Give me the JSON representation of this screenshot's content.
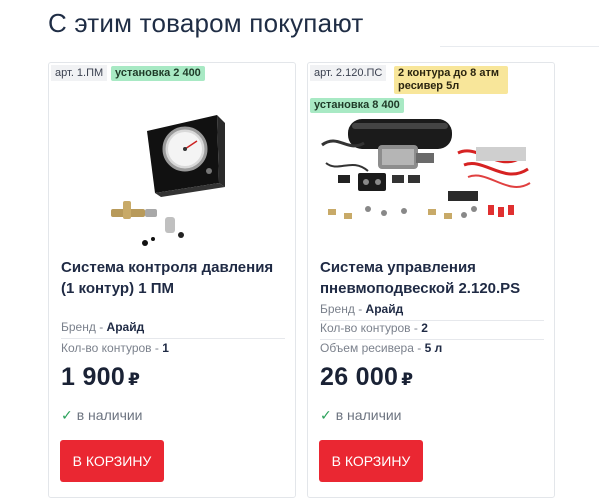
{
  "section": {
    "title": "С этим товаром покупают"
  },
  "currency_symbol": "₽",
  "cards": [
    {
      "article": "арт. 1.ПМ",
      "badges": [
        "установка 2 400"
      ],
      "name": "Система контроля давления (1 контур) 1 ПМ",
      "specs": [
        {
          "label": "Бренд",
          "value": "Арайд"
        },
        {
          "label": "Кол-во контуров",
          "value": "1"
        }
      ],
      "price": "1 900",
      "stock": "в наличии",
      "cart_label": "В КОРЗИНУ"
    },
    {
      "article": "арт. 2.120.ПС",
      "badges": [
        "2 контура до 8 атм ресивер 5л",
        "установка 8 400"
      ],
      "name": "Система управления пневмоподвеской 2.120.PS",
      "specs": [
        {
          "label": "Бренд",
          "value": "Арайд"
        },
        {
          "label": "Кол-во контуров",
          "value": "2"
        },
        {
          "label": "Объем ресивера",
          "value": "5 л"
        }
      ],
      "price": "26 000",
      "stock": "в наличии",
      "cart_label": "В КОРЗИНУ"
    }
  ],
  "colors": {
    "accent_button": "#ea2732",
    "badge_green": "#a8e9c4",
    "badge_yellow": "#f8e69a",
    "in_stock_check": "#2aa15a"
  },
  "icons": [
    "check-icon"
  ]
}
